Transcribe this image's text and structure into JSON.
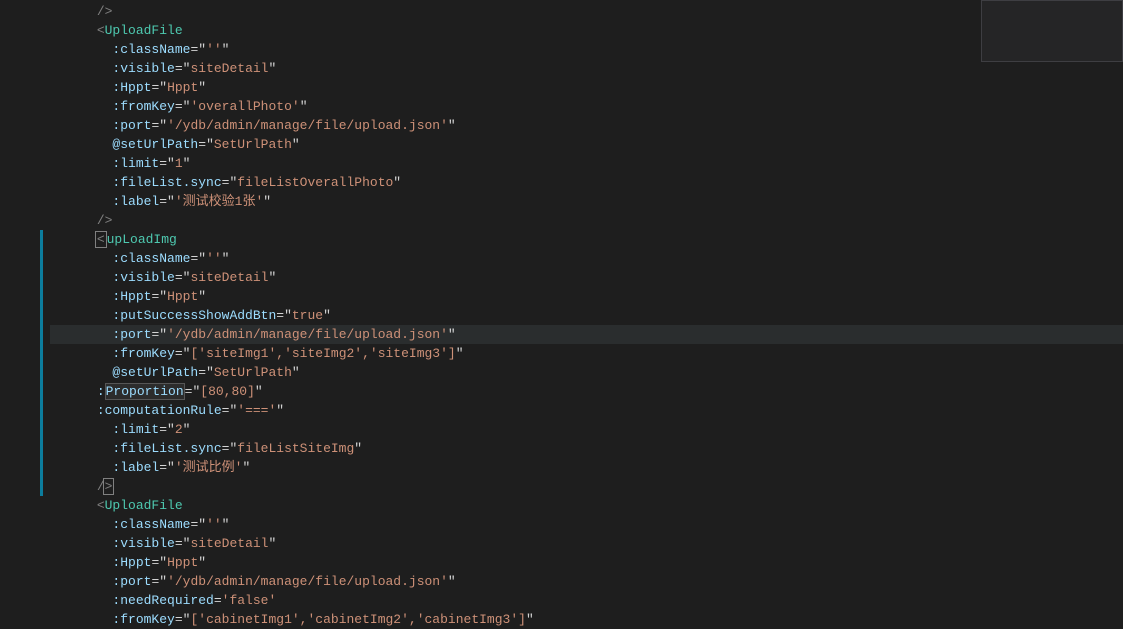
{
  "lines": [
    {
      "indent": 3,
      "content": [
        {
          "t": "tag",
          "v": "/>"
        }
      ]
    },
    {
      "indent": 3,
      "content": [
        {
          "t": "tag",
          "v": "<"
        },
        {
          "t": "component",
          "v": "UploadFile"
        }
      ]
    },
    {
      "indent": 4,
      "content": [
        {
          "t": "attr",
          "v": ":className"
        },
        {
          "t": "eq",
          "v": "="
        },
        {
          "t": "quote",
          "v": "\""
        },
        {
          "t": "str",
          "v": "''"
        },
        {
          "t": "quote",
          "v": "\""
        }
      ]
    },
    {
      "indent": 4,
      "content": [
        {
          "t": "attr",
          "v": ":visible"
        },
        {
          "t": "eq",
          "v": "="
        },
        {
          "t": "quote",
          "v": "\""
        },
        {
          "t": "str",
          "v": "siteDetail"
        },
        {
          "t": "quote",
          "v": "\""
        }
      ]
    },
    {
      "indent": 4,
      "content": [
        {
          "t": "attr",
          "v": ":Hppt"
        },
        {
          "t": "eq",
          "v": "="
        },
        {
          "t": "quote",
          "v": "\""
        },
        {
          "t": "str",
          "v": "Hppt"
        },
        {
          "t": "quote",
          "v": "\""
        }
      ]
    },
    {
      "indent": 4,
      "content": [
        {
          "t": "attr",
          "v": ":fromKey"
        },
        {
          "t": "eq",
          "v": "="
        },
        {
          "t": "quote",
          "v": "\""
        },
        {
          "t": "str",
          "v": "'overallPhoto'"
        },
        {
          "t": "quote",
          "v": "\""
        }
      ]
    },
    {
      "indent": 4,
      "guide": true,
      "content": [
        {
          "t": "attr",
          "v": ":port"
        },
        {
          "t": "eq",
          "v": "="
        },
        {
          "t": "quote",
          "v": "\""
        },
        {
          "t": "str",
          "v": "'/ydb/admin/manage/file/upload.json'"
        },
        {
          "t": "quote",
          "v": "\""
        }
      ]
    },
    {
      "indent": 4,
      "content": [
        {
          "t": "attr",
          "v": "@setUrlPath"
        },
        {
          "t": "eq",
          "v": "="
        },
        {
          "t": "quote",
          "v": "\""
        },
        {
          "t": "str",
          "v": "SetUrlPath"
        },
        {
          "t": "quote",
          "v": "\""
        }
      ]
    },
    {
      "indent": 4,
      "content": [
        {
          "t": "attr",
          "v": ":limit"
        },
        {
          "t": "eq",
          "v": "="
        },
        {
          "t": "quote",
          "v": "\""
        },
        {
          "t": "str",
          "v": "1"
        },
        {
          "t": "quote",
          "v": "\""
        }
      ]
    },
    {
      "indent": 4,
      "content": [
        {
          "t": "attr",
          "v": ":fileList.sync"
        },
        {
          "t": "eq",
          "v": "="
        },
        {
          "t": "quote",
          "v": "\""
        },
        {
          "t": "str",
          "v": "fileListOverallPhoto"
        },
        {
          "t": "quote",
          "v": "\""
        }
      ]
    },
    {
      "indent": 4,
      "content": [
        {
          "t": "attr",
          "v": ":label"
        },
        {
          "t": "eq",
          "v": "="
        },
        {
          "t": "quote",
          "v": "\""
        },
        {
          "t": "str",
          "v": "'测试校验1张'"
        },
        {
          "t": "quote",
          "v": "\""
        }
      ]
    },
    {
      "indent": 3,
      "content": [
        {
          "t": "tag",
          "v": "/>"
        }
      ]
    },
    {
      "indent": 3,
      "cursorStart": true,
      "content": [
        {
          "t": "component",
          "v": "upLoadImg"
        }
      ]
    },
    {
      "indent": 4,
      "content": [
        {
          "t": "attr",
          "v": ":className"
        },
        {
          "t": "eq",
          "v": "="
        },
        {
          "t": "quote",
          "v": "\""
        },
        {
          "t": "str",
          "v": "''"
        },
        {
          "t": "quote",
          "v": "\""
        }
      ]
    },
    {
      "indent": 4,
      "content": [
        {
          "t": "attr",
          "v": ":visible"
        },
        {
          "t": "eq",
          "v": "="
        },
        {
          "t": "quote",
          "v": "\""
        },
        {
          "t": "str",
          "v": "siteDetail"
        },
        {
          "t": "quote",
          "v": "\""
        }
      ]
    },
    {
      "indent": 4,
      "content": [
        {
          "t": "attr",
          "v": ":Hppt"
        },
        {
          "t": "eq",
          "v": "="
        },
        {
          "t": "quote",
          "v": "\""
        },
        {
          "t": "str",
          "v": "Hppt"
        },
        {
          "t": "quote",
          "v": "\""
        }
      ]
    },
    {
      "indent": 4,
      "content": [
        {
          "t": "attr",
          "v": ":putSuccessShowAddBtn"
        },
        {
          "t": "eq",
          "v": "="
        },
        {
          "t": "quote",
          "v": "\""
        },
        {
          "t": "str",
          "v": "true"
        },
        {
          "t": "quote",
          "v": "\""
        }
      ]
    },
    {
      "indent": 4,
      "hl": true,
      "content": [
        {
          "t": "attr",
          "v": ":port"
        },
        {
          "t": "eq",
          "v": "="
        },
        {
          "t": "quote",
          "v": "\""
        },
        {
          "t": "str",
          "v": "'/ydb/admin/manage/file/upload.json'"
        },
        {
          "t": "quote",
          "v": "\""
        }
      ]
    },
    {
      "indent": 4,
      "content": [
        {
          "t": "attr",
          "v": ":fromKey"
        },
        {
          "t": "eq",
          "v": "="
        },
        {
          "t": "quote",
          "v": "\""
        },
        {
          "t": "str",
          "v": "['siteImg1','siteImg2','siteImg3']"
        },
        {
          "t": "quote",
          "v": "\""
        }
      ]
    },
    {
      "indent": 4,
      "content": [
        {
          "t": "attr",
          "v": "@setUrlPath"
        },
        {
          "t": "eq",
          "v": "="
        },
        {
          "t": "quote",
          "v": "\""
        },
        {
          "t": "str",
          "v": "SetUrlPath"
        },
        {
          "t": "quote",
          "v": "\""
        }
      ]
    },
    {
      "indent": 3,
      "content": [
        {
          "t": "attr",
          "v": ":"
        },
        {
          "t": "attr",
          "v": "Proportion",
          "sel": true
        },
        {
          "t": "eq",
          "v": "="
        },
        {
          "t": "quote",
          "v": "\""
        },
        {
          "t": "str",
          "v": "[80,80]"
        },
        {
          "t": "quote",
          "v": "\""
        }
      ]
    },
    {
      "indent": 3,
      "content": [
        {
          "t": "attr",
          "v": ":computationRule"
        },
        {
          "t": "eq",
          "v": "="
        },
        {
          "t": "quote",
          "v": "\""
        },
        {
          "t": "str",
          "v": "'==='"
        },
        {
          "t": "quote",
          "v": "\""
        }
      ]
    },
    {
      "indent": 4,
      "content": [
        {
          "t": "attr",
          "v": ":limit"
        },
        {
          "t": "eq",
          "v": "="
        },
        {
          "t": "quote",
          "v": "\""
        },
        {
          "t": "str",
          "v": "2"
        },
        {
          "t": "quote",
          "v": "\""
        }
      ]
    },
    {
      "indent": 4,
      "content": [
        {
          "t": "attr",
          "v": ":fileList.sync"
        },
        {
          "t": "eq",
          "v": "="
        },
        {
          "t": "quote",
          "v": "\""
        },
        {
          "t": "str",
          "v": "fileListSiteImg"
        },
        {
          "t": "quote",
          "v": "\""
        }
      ]
    },
    {
      "indent": 4,
      "content": [
        {
          "t": "attr",
          "v": ":label"
        },
        {
          "t": "eq",
          "v": "="
        },
        {
          "t": "quote",
          "v": "\""
        },
        {
          "t": "str",
          "v": "'测试比例'"
        },
        {
          "t": "quote",
          "v": "\""
        }
      ]
    },
    {
      "indent": 3,
      "cursorEnd": true,
      "content": [
        {
          "t": "tag",
          "v": "/"
        }
      ]
    },
    {
      "indent": 3,
      "content": [
        {
          "t": "tag",
          "v": "<"
        },
        {
          "t": "component",
          "v": "UploadFile"
        }
      ]
    },
    {
      "indent": 4,
      "content": [
        {
          "t": "attr",
          "v": ":className"
        },
        {
          "t": "eq",
          "v": "="
        },
        {
          "t": "quote",
          "v": "\""
        },
        {
          "t": "str",
          "v": "''"
        },
        {
          "t": "quote",
          "v": "\""
        }
      ]
    },
    {
      "indent": 4,
      "content": [
        {
          "t": "attr",
          "v": ":visible"
        },
        {
          "t": "eq",
          "v": "="
        },
        {
          "t": "quote",
          "v": "\""
        },
        {
          "t": "str",
          "v": "siteDetail"
        },
        {
          "t": "quote",
          "v": "\""
        }
      ]
    },
    {
      "indent": 4,
      "content": [
        {
          "t": "attr",
          "v": ":Hppt"
        },
        {
          "t": "eq",
          "v": "="
        },
        {
          "t": "quote",
          "v": "\""
        },
        {
          "t": "str",
          "v": "Hppt"
        },
        {
          "t": "quote",
          "v": "\""
        }
      ]
    },
    {
      "indent": 4,
      "content": [
        {
          "t": "attr",
          "v": ":port"
        },
        {
          "t": "eq",
          "v": "="
        },
        {
          "t": "quote",
          "v": "\""
        },
        {
          "t": "str",
          "v": "'/ydb/admin/manage/file/upload.json'"
        },
        {
          "t": "quote",
          "v": "\""
        }
      ]
    },
    {
      "indent": 4,
      "content": [
        {
          "t": "attr",
          "v": ":needRequired"
        },
        {
          "t": "eq",
          "v": "="
        },
        {
          "t": "str",
          "v": "'false'"
        }
      ]
    },
    {
      "indent": 4,
      "content": [
        {
          "t": "attr",
          "v": ":fromKey"
        },
        {
          "t": "eq",
          "v": "="
        },
        {
          "t": "quote",
          "v": "\""
        },
        {
          "t": "str",
          "v": "['cabinetImg1','cabinetImg2','cabinetImg3']"
        },
        {
          "t": "quote",
          "v": "\""
        }
      ]
    }
  ],
  "modifiedLines": [
    12,
    13,
    14,
    15,
    16,
    17,
    18,
    19,
    20,
    21,
    22,
    23,
    24,
    25
  ]
}
